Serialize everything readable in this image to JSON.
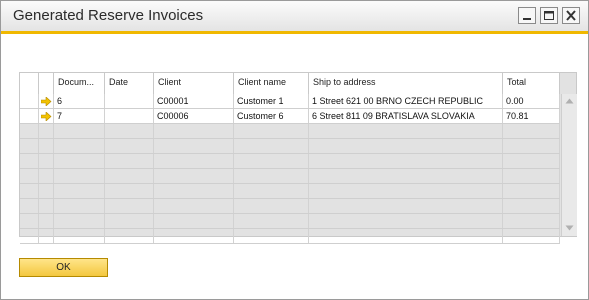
{
  "window": {
    "title": "Generated Reserve Invoices"
  },
  "grid": {
    "columns": [
      "",
      "Docum...",
      "Date",
      "Client",
      "Client name",
      "Ship to address",
      "Total"
    ],
    "rows": [
      {
        "doc": "6",
        "date": "",
        "client": "C00001",
        "client_name": "Customer 1",
        "ship_to": "1 Street  621 00 BRNO CZECH REPUBLIC",
        "total": "0.00"
      },
      {
        "doc": "7",
        "date": "",
        "client": "C00006",
        "client_name": "Customer 6",
        "ship_to": "6 Street  811 09 BRATISLAVA SLOVAKIA",
        "total": "70.81"
      }
    ]
  },
  "buttons": {
    "ok": "OK"
  },
  "colors": {
    "accent": "#f0b800",
    "arrow": "#f2c200",
    "ok_top": "#ffe58a",
    "ok_bottom": "#f3c73f"
  },
  "icons": {
    "row_link": "link-arrow-icon",
    "minimize": "minimize-icon",
    "maximize": "maximize-icon",
    "close": "close-icon"
  }
}
